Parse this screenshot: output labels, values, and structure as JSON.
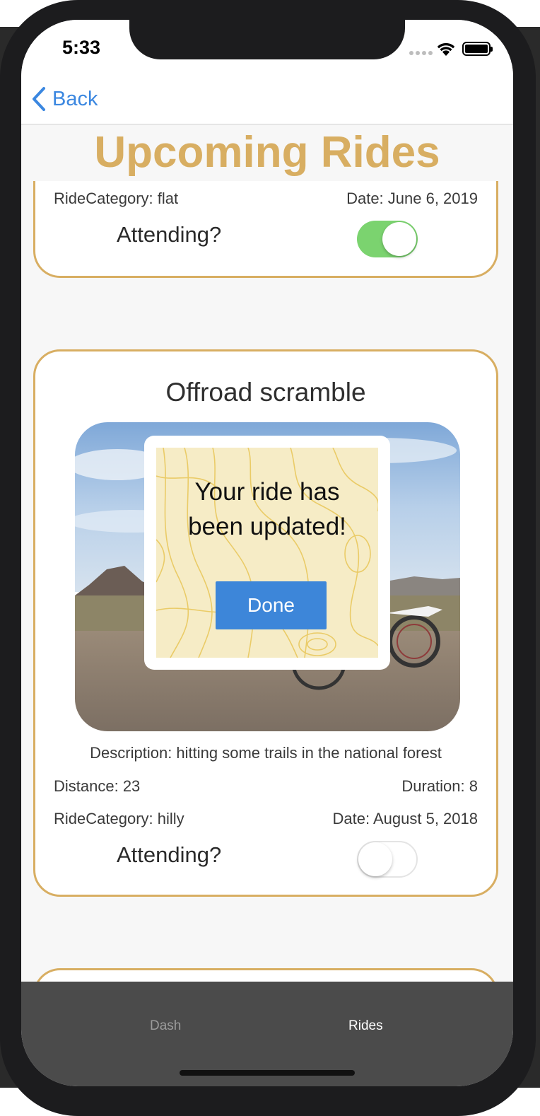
{
  "status_bar": {
    "time": "5:33"
  },
  "nav": {
    "back_label": "Back"
  },
  "page": {
    "title": "Upcoming Rides"
  },
  "rides": [
    {
      "ride_category": "RideCategory: flat",
      "date": "Date: June 6, 2019",
      "attending_label": "Attending?",
      "attending": true
    },
    {
      "title": "Offroad scramble",
      "description": "Description: hitting some trails in the national forest",
      "distance": "Distance: 23",
      "duration": "Duration: 8",
      "ride_category": "RideCategory: hilly",
      "date": "Date: August 5, 2018",
      "attending_label": "Attending?",
      "attending": false
    }
  ],
  "modal": {
    "message_line1": "Your ride has",
    "message_line2": "been updated!",
    "done_label": "Done"
  },
  "tabs": [
    {
      "label": "Dash",
      "active": false
    },
    {
      "label": "Rides",
      "active": true
    }
  ],
  "colors": {
    "accent_gold": "#d8ae62",
    "link_blue": "#3b87e0",
    "toggle_on": "#7bd36f",
    "done_button": "#3d86d9",
    "tabbar": "#4b4b4b"
  }
}
